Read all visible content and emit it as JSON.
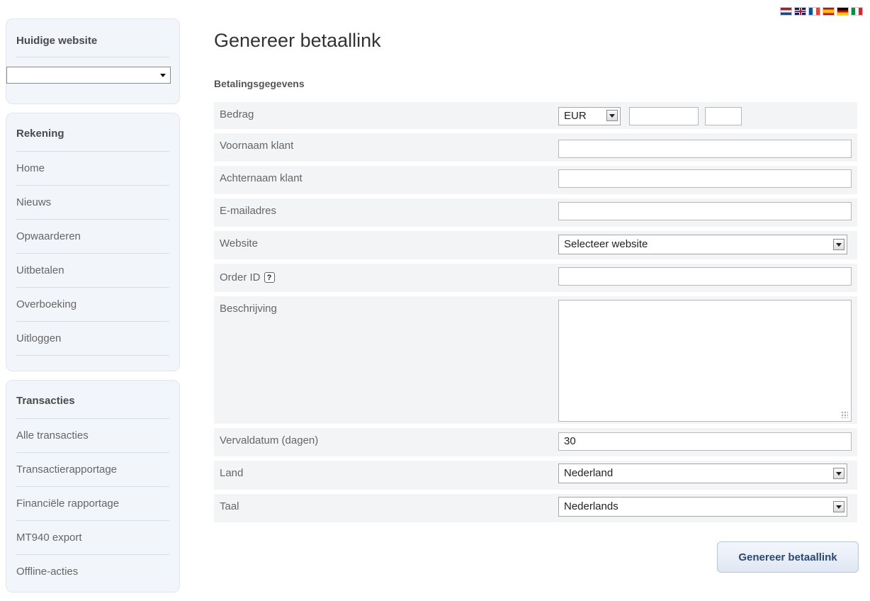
{
  "flags": [
    "flag-nl-icon",
    "flag-gb-icon",
    "flag-fr-icon",
    "flag-es-icon",
    "flag-de-icon",
    "flag-it-icon"
  ],
  "sidebar": {
    "current_website_title": "Huidige website",
    "current_website_value": "",
    "account": {
      "title": "Rekening",
      "items": [
        "Home",
        "Nieuws",
        "Opwaarderen",
        "Uitbetalen",
        "Overboeking",
        "Uitloggen"
      ]
    },
    "transactions": {
      "title": "Transacties",
      "items": [
        "Alle transacties",
        "Transactierapportage",
        "Financiële rapportage",
        "MT940 export",
        "Offline-acties"
      ]
    }
  },
  "main": {
    "title": "Genereer betaallink",
    "section": "Betalingsgegevens",
    "form": {
      "amount_label": "Bedrag",
      "currency": "EUR",
      "amount_whole": "",
      "amount_cents": "",
      "first_name_label": "Voornaam klant",
      "first_name": "",
      "last_name_label": "Achternaam klant",
      "last_name": "",
      "email_label": "E-mailadres",
      "email": "",
      "website_label": "Website",
      "website_value": "Selecteer website",
      "order_id_label": "Order ID",
      "order_id_help": "?",
      "order_id": "",
      "description_label": "Beschrijving",
      "description": "",
      "expiry_label": "Vervaldatum (dagen)",
      "expiry": "30",
      "country_label": "Land",
      "country": "Nederland",
      "language_label": "Taal",
      "language": "Nederlands"
    },
    "submit": "Genereer betaallink"
  }
}
